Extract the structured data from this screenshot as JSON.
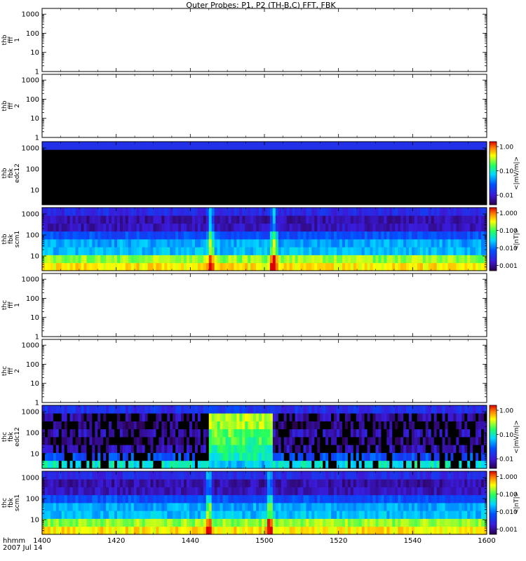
{
  "title": "Outer Probes: P1, P2 (TH-B,C) FFT, FBK",
  "footer": {
    "time_label": "hhmm",
    "date_label": "2007 Jul 14"
  },
  "chart_data": {
    "type": "heatmap",
    "x": {
      "ticks": [
        "1400",
        "1420",
        "1440",
        "1500",
        "1520",
        "1540",
        "1600"
      ],
      "tick_minutes": [
        0,
        20,
        40,
        60,
        80,
        100,
        120
      ],
      "range_minutes": [
        0,
        120
      ],
      "start": "2007 Jul 14 14:00",
      "end": "2007 Jul 14 16:00"
    },
    "panels": [
      {
        "ylabel": [
          "thb",
          "fff",
          "1"
        ],
        "yscale": "log",
        "yticks": [
          "1000",
          "100",
          "10",
          "1"
        ],
        "ylim": [
          1,
          2000
        ],
        "has_data": false
      },
      {
        "ylabel": [
          "thb",
          "fff",
          "2"
        ],
        "yscale": "log",
        "yticks": [
          "1000",
          "100",
          "10",
          "1"
        ],
        "ylim": [
          1,
          2000
        ],
        "has_data": false
      },
      {
        "ylabel": [
          "thb",
          "fbk",
          "edc12"
        ],
        "yscale": "log",
        "yticks": [
          "1000",
          "100",
          "10"
        ],
        "ylim": [
          2,
          2000
        ],
        "has_data": true,
        "profile": "flat_black",
        "colorbar": {
          "label": "<|mV/m|>",
          "ticks": [
            "1.00",
            "0.10",
            "0.01"
          ],
          "range": [
            0.004,
            1.6
          ]
        }
      },
      {
        "ylabel": [
          "thb",
          "fbk",
          "scm1"
        ],
        "yscale": "log",
        "yticks": [
          "1000",
          "100",
          "10"
        ],
        "ylim": [
          2,
          2000
        ],
        "has_data": true,
        "profile": "scm",
        "events_minutes": [
          45.5,
          62.5
        ],
        "colorbar": {
          "label": "<|nT|>",
          "ticks": [
            "1.000",
            "0.100",
            "0.010",
            "0.001"
          ],
          "range": [
            0.0005,
            2.0
          ]
        }
      },
      {
        "ylabel": [
          "thc",
          "fff",
          "1"
        ],
        "yscale": "log",
        "yticks": [
          "1000",
          "100",
          "10",
          "1"
        ],
        "ylim": [
          1,
          2000
        ],
        "has_data": false
      },
      {
        "ylabel": [
          "thc",
          "fff",
          "2"
        ],
        "yscale": "log",
        "yticks": [
          "1000",
          "100",
          "10",
          "1"
        ],
        "ylim": [
          1,
          2000
        ],
        "has_data": false
      },
      {
        "ylabel": [
          "thc",
          "fbk",
          "edc12"
        ],
        "yscale": "log",
        "yticks": [
          "1000",
          "100",
          "10"
        ],
        "ylim": [
          2,
          2000
        ],
        "has_data": true,
        "profile": "edc_active",
        "active_interval_minutes": [
          45,
          62
        ],
        "colorbar": {
          "label": "<|mV/m|>",
          "ticks": [
            "1.00",
            "0.10",
            "0.01"
          ],
          "range": [
            0.004,
            1.6
          ]
        }
      },
      {
        "ylabel": [
          "thc",
          "fbk",
          "scm1"
        ],
        "yscale": "log",
        "yticks": [
          "1000",
          "100",
          "10"
        ],
        "ylim": [
          2,
          2000
        ],
        "has_data": true,
        "profile": "scm",
        "events_minutes": [
          45,
          61.5
        ],
        "colorbar": {
          "label": "<|nT|>",
          "ticks": [
            "1.000",
            "0.100",
            "0.010",
            "0.001"
          ],
          "range": [
            0.0005,
            2.0
          ]
        }
      }
    ]
  }
}
